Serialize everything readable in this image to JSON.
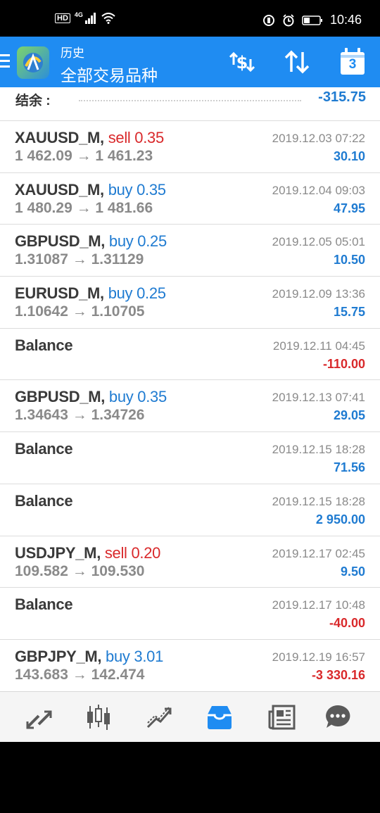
{
  "status_bar": {
    "hd": "HD",
    "net": "4G",
    "time": "10:46"
  },
  "header": {
    "subtitle": "历史",
    "title": "全部交易品种",
    "calendar_day": "3"
  },
  "summary": {
    "label": "结余 :",
    "value": "-315.75"
  },
  "rows": [
    {
      "symbol": "XAUUSD_M,",
      "side": "sell 0.35",
      "side_type": "sell",
      "prices": "1 462.09 → 1 461.23",
      "date": "2019.12.03 07:22",
      "profit": "30.10",
      "profit_sign": "pos"
    },
    {
      "symbol": "XAUUSD_M,",
      "side": "buy 0.35",
      "side_type": "buy",
      "prices": "1 480.29 → 1 481.66",
      "date": "2019.12.04 09:03",
      "profit": "47.95",
      "profit_sign": "pos"
    },
    {
      "symbol": "GBPUSD_M,",
      "side": "buy 0.25",
      "side_type": "buy",
      "prices": "1.31087 → 1.31129",
      "date": "2019.12.05 05:01",
      "profit": "10.50",
      "profit_sign": "pos"
    },
    {
      "symbol": "EURUSD_M,",
      "side": "buy 0.25",
      "side_type": "buy",
      "prices": "1.10642 → 1.10705",
      "date": "2019.12.09 13:36",
      "profit": "15.75",
      "profit_sign": "pos"
    },
    {
      "symbol": "Balance",
      "side": "",
      "side_type": "",
      "prices": "",
      "date": "2019.12.11 04:45",
      "profit": "-110.00",
      "profit_sign": "neg"
    },
    {
      "symbol": "GBPUSD_M,",
      "side": "buy 0.35",
      "side_type": "buy",
      "prices": "1.34643 → 1.34726",
      "date": "2019.12.13 07:41",
      "profit": "29.05",
      "profit_sign": "pos"
    },
    {
      "symbol": "Balance",
      "side": "",
      "side_type": "",
      "prices": "",
      "date": "2019.12.15 18:28",
      "profit": "71.56",
      "profit_sign": "pos"
    },
    {
      "symbol": "Balance",
      "side": "",
      "side_type": "",
      "prices": "",
      "date": "2019.12.15 18:28",
      "profit": "2 950.00",
      "profit_sign": "pos"
    },
    {
      "symbol": "USDJPY_M,",
      "side": "sell 0.20",
      "side_type": "sell",
      "prices": "109.582 → 109.530",
      "date": "2019.12.17 02:45",
      "profit": "9.50",
      "profit_sign": "pos"
    },
    {
      "symbol": "Balance",
      "side": "",
      "side_type": "",
      "prices": "",
      "date": "2019.12.17 10:48",
      "profit": "-40.00",
      "profit_sign": "neg"
    },
    {
      "symbol": "GBPJPY_M,",
      "side": "buy 3.01",
      "side_type": "buy",
      "prices": "143.683 → 142.474",
      "date": "2019.12.19 16:57",
      "profit": "-3 330.16",
      "profit_sign": "neg"
    }
  ],
  "bottom_nav": [
    {
      "icon": "quotes-icon",
      "active": false
    },
    {
      "icon": "chart-icon",
      "active": false
    },
    {
      "icon": "trade-icon",
      "active": false
    },
    {
      "icon": "history-icon",
      "active": true
    },
    {
      "icon": "news-icon",
      "active": false
    },
    {
      "icon": "chat-icon",
      "active": false
    }
  ],
  "colors": {
    "accent": "#1f8cf2",
    "buy": "#1f7bd1",
    "sell": "#d9292b",
    "active_nav": "#1f8cf2",
    "inactive_nav": "#5a5a5a"
  }
}
